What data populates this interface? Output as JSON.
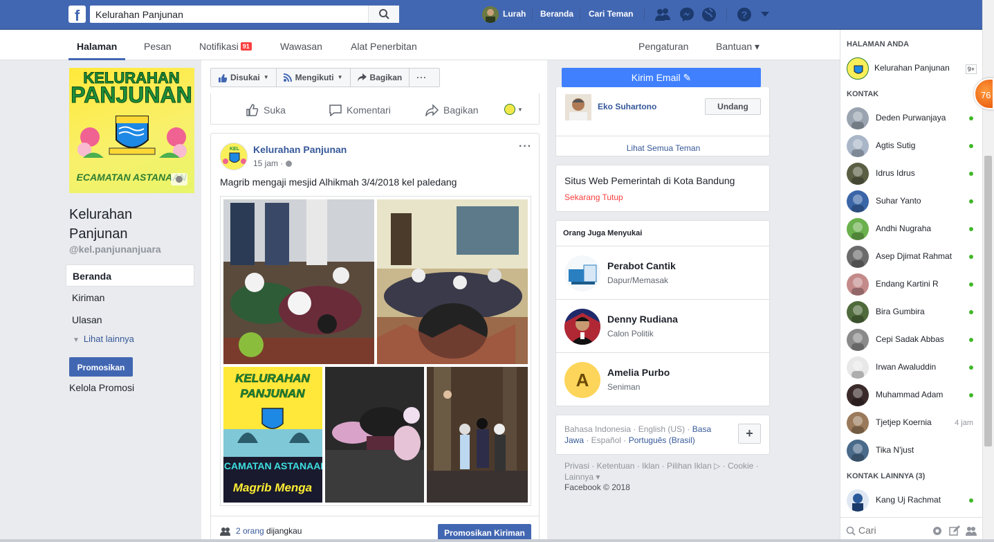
{
  "topbar": {
    "logo_letter": "f",
    "search_value": "Kelurahan Panjunan",
    "profile_name": "Lurah",
    "nav_home": "Beranda",
    "nav_find_friends": "Cari Teman",
    "icons": [
      "friend-requests-icon",
      "messenger-icon",
      "globe-icon",
      "help-icon",
      "chevron-down-icon"
    ]
  },
  "subnav": {
    "tabs": [
      {
        "label": "Halaman"
      },
      {
        "label": "Pesan"
      },
      {
        "label": "Notifikasi",
        "badge": "91"
      },
      {
        "label": "Wawasan"
      },
      {
        "label": "Alat Penerbitan"
      }
    ],
    "settings": "Pengaturan",
    "help": "Bantuan ▾"
  },
  "left": {
    "page_name": "Kelurahan Panjunan",
    "handle": "@kel.panjunanjuara",
    "cover_text": {
      "line1": "KELURAHAN",
      "line2": "PANJUNAN",
      "bottom": "ECAMATAN ASTANAAN"
    },
    "menu": [
      "Beranda",
      "Kiriman",
      "Ulasan"
    ],
    "more": "Lihat lainnya",
    "promote": "Promosikan",
    "manage_promo": "Kelola Promosi"
  },
  "action_bar": {
    "liked": "Disukai",
    "following": "Mengikuti",
    "share": "Bagikan",
    "more": "···"
  },
  "reactions": {
    "like": "Suka",
    "comment": "Komentari",
    "share": "Bagikan"
  },
  "post": {
    "author": "Kelurahan Panjunan",
    "time": "15 jam · ",
    "menu": "···",
    "text": "Magrib mengaji mesjid Alhikmah 3/4/2018 kel paledang",
    "poster_text": {
      "line1": "KELURAHAN",
      "line2": "PANJUNAN",
      "line3": "ECAMATAN ASTANAAN",
      "line4": "Magrib Menga"
    },
    "reach_count": "2 orang",
    "reach_suffix": " dijangkau",
    "boost": "Promosikan Kiriman"
  },
  "right": {
    "email_btn": "Kirim Email ✎",
    "invite": {
      "name": "Eko Suhartono",
      "button": "Undang",
      "see_all": "Lihat Semua Teman"
    },
    "website": {
      "title": "Situs Web Pemerintah di Kota Bandung",
      "status": "Sekarang Tutup"
    },
    "people_header": "Orang Juga Menyukai",
    "people": [
      {
        "name": "Perabot Cantik",
        "category": "Dapur/Memasak"
      },
      {
        "name": "Denny Rudiana",
        "category": "Calon Politik"
      },
      {
        "name": "Amelia Purbo",
        "category": "Seniman",
        "initial": "A"
      }
    ],
    "languages": {
      "current": "Bahasa Indonesia",
      "others": [
        " · English (US) · ",
        "Basa Jawa",
        " · Español · ",
        "Português (Brasil)"
      ],
      "plus": "+"
    },
    "footer_links": "Privasi · Ketentuan · Iklan · Pilihan Iklan ▷ · Cookie · Lainnya ▾",
    "copyright": "Facebook © 2018"
  },
  "chat": {
    "your_pages_header": "HALAMAN ANDA",
    "your_page": {
      "name": "Kelurahan Panjunan",
      "badge": "9+"
    },
    "contacts_header": "KONTAK",
    "contacts": [
      {
        "name": "Deden Purwanjaya",
        "status": "online"
      },
      {
        "name": "Agtis Sutig",
        "status": "online"
      },
      {
        "name": "Idrus Idrus",
        "status": "online"
      },
      {
        "name": "Suhar Yanto",
        "status": "online"
      },
      {
        "name": "Andhi Nugraha",
        "status": "online"
      },
      {
        "name": "Asep Djimat Rahmat",
        "status": "online"
      },
      {
        "name": "Endang Kartini R",
        "status": "online"
      },
      {
        "name": "Bira Gumbira",
        "status": "online"
      },
      {
        "name": "Cepi Sadak Abbas",
        "status": "online"
      },
      {
        "name": "Irwan Awaluddin",
        "status": "online"
      },
      {
        "name": "Muhammad Adam",
        "status": "online"
      },
      {
        "name": "Tjetjep Koernia",
        "status": "4 jam"
      },
      {
        "name": "Tika N'just",
        "status": ""
      }
    ],
    "other_contacts_header": "KONTAK LAINNYA (3)",
    "other_contacts": [
      {
        "name": "Kang Uj Rachmat",
        "status": "online"
      }
    ],
    "search_placeholder": "Cari"
  },
  "floating_badge": "76",
  "colors": {
    "brand": "#4267b2",
    "online": "#42b72a",
    "link": "#365899",
    "closed": "#fa3e3e"
  }
}
